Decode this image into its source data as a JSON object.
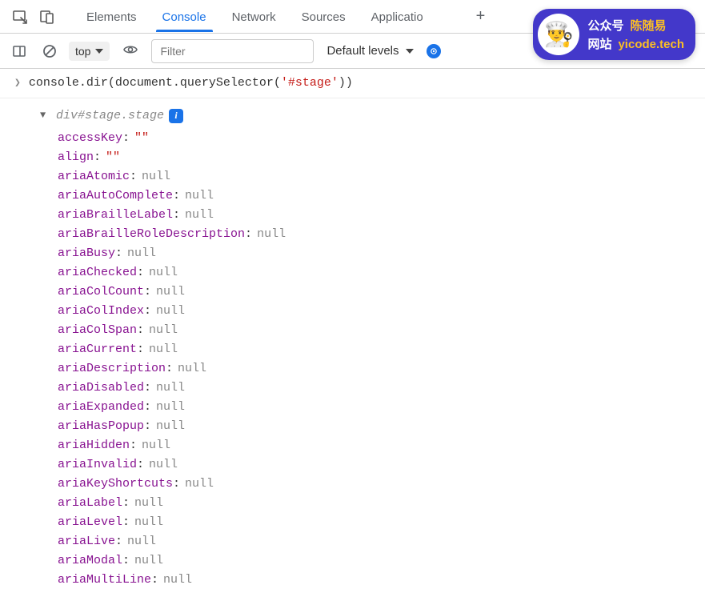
{
  "tabs": {
    "elements": "Elements",
    "console": "Console",
    "network": "Network",
    "sources": "Sources",
    "application": "Applicatio"
  },
  "toolbar": {
    "context": "top",
    "filter_placeholder": "Filter",
    "levels": "Default levels"
  },
  "command": {
    "prefix": "console.dir(document.querySelector(",
    "arg": "'#stage'",
    "suffix": "))"
  },
  "inspector": {
    "header": "div#stage.stage",
    "info_symbol": "i",
    "properties": [
      {
        "key": "accessKey",
        "type": "str",
        "val": "\"\""
      },
      {
        "key": "align",
        "type": "str",
        "val": "\"\""
      },
      {
        "key": "ariaAtomic",
        "type": "null",
        "val": "null"
      },
      {
        "key": "ariaAutoComplete",
        "type": "null",
        "val": "null"
      },
      {
        "key": "ariaBrailleLabel",
        "type": "null",
        "val": "null"
      },
      {
        "key": "ariaBrailleRoleDescription",
        "type": "null",
        "val": "null"
      },
      {
        "key": "ariaBusy",
        "type": "null",
        "val": "null"
      },
      {
        "key": "ariaChecked",
        "type": "null",
        "val": "null"
      },
      {
        "key": "ariaColCount",
        "type": "null",
        "val": "null"
      },
      {
        "key": "ariaColIndex",
        "type": "null",
        "val": "null"
      },
      {
        "key": "ariaColSpan",
        "type": "null",
        "val": "null"
      },
      {
        "key": "ariaCurrent",
        "type": "null",
        "val": "null"
      },
      {
        "key": "ariaDescription",
        "type": "null",
        "val": "null"
      },
      {
        "key": "ariaDisabled",
        "type": "null",
        "val": "null"
      },
      {
        "key": "ariaExpanded",
        "type": "null",
        "val": "null"
      },
      {
        "key": "ariaHasPopup",
        "type": "null",
        "val": "null"
      },
      {
        "key": "ariaHidden",
        "type": "null",
        "val": "null"
      },
      {
        "key": "ariaInvalid",
        "type": "null",
        "val": "null"
      },
      {
        "key": "ariaKeyShortcuts",
        "type": "null",
        "val": "null"
      },
      {
        "key": "ariaLabel",
        "type": "null",
        "val": "null"
      },
      {
        "key": "ariaLevel",
        "type": "null",
        "val": "null"
      },
      {
        "key": "ariaLive",
        "type": "null",
        "val": "null"
      },
      {
        "key": "ariaModal",
        "type": "null",
        "val": "null"
      },
      {
        "key": "ariaMultiLine",
        "type": "null",
        "val": "null"
      }
    ]
  },
  "watermark": {
    "row1_label": "公众号",
    "row1_value": "陈随易",
    "row2_label": "网站",
    "row2_value": "yicode.tech"
  }
}
